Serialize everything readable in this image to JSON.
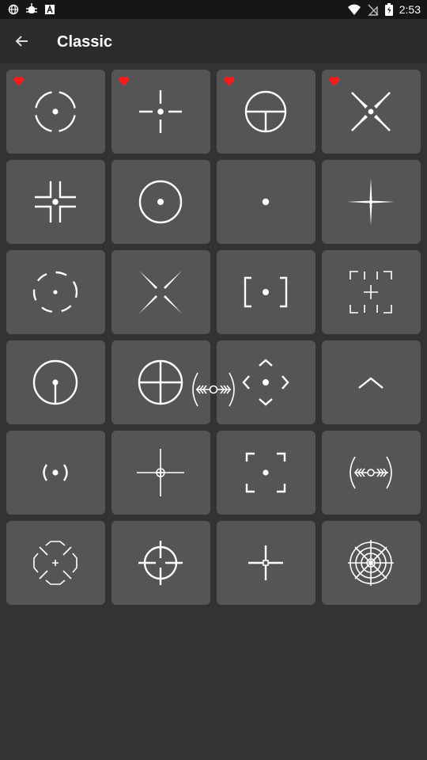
{
  "status_bar": {
    "time": "2:53",
    "left_icons": [
      "globe-icon",
      "bug-icon",
      "font-icon"
    ],
    "right_icons": [
      "wifi-icon",
      "no-sim-icon",
      "battery-icon"
    ],
    "background": "#161616"
  },
  "app_bar": {
    "title": "Classic",
    "back_icon": "arrow-back-icon",
    "background": "#2b2b2b"
  },
  "colors": {
    "background": "#333333",
    "tile": "#555555",
    "crosshair": "#ffffff",
    "favorite": "#ff1a1a"
  },
  "crosshairs": [
    {
      "id": 1,
      "style": "broken-circle-dot",
      "favorite": true
    },
    {
      "id": 2,
      "style": "cross-gap-dot",
      "favorite": true
    },
    {
      "id": 3,
      "style": "circle-t-scope",
      "favorite": true
    },
    {
      "id": 4,
      "style": "diagonal-x-dot",
      "favorite": true
    },
    {
      "id": 5,
      "style": "corner-brackets-dot",
      "favorite": false
    },
    {
      "id": 6,
      "style": "circle-dot",
      "favorite": false
    },
    {
      "id": 7,
      "style": "single-dot",
      "favorite": false
    },
    {
      "id": 8,
      "style": "tapered-star-cross",
      "favorite": false
    },
    {
      "id": 9,
      "style": "dashed-circle-dot",
      "favorite": false
    },
    {
      "id": 10,
      "style": "diagonal-blades",
      "favorite": false
    },
    {
      "id": 11,
      "style": "square-brackets-dot",
      "favorite": false
    },
    {
      "id": 12,
      "style": "frame-corners-small-cross",
      "favorite": false
    },
    {
      "id": 13,
      "style": "circle-vertical-line-dot",
      "favorite": false
    },
    {
      "id": 14,
      "style": "circle-full-cross",
      "favorite": false
    },
    {
      "id": 15,
      "style": "diamond-chevrons-dot",
      "favorite": false
    },
    {
      "id": 16,
      "style": "chevron-up",
      "favorite": false
    },
    {
      "id": 17,
      "style": "parentheses-dot",
      "favorite": false
    },
    {
      "id": 18,
      "style": "long-cross-small-circle",
      "favorite": false
    },
    {
      "id": 19,
      "style": "square-corners-dot",
      "favorite": false
    },
    {
      "id": 20,
      "style": "arcs-arrows-circle",
      "favorite": false
    },
    {
      "id": 21,
      "style": "rounded-diamond-plus",
      "favorite": false
    },
    {
      "id": 22,
      "style": "circle-cross-scope",
      "favorite": false
    },
    {
      "id": 23,
      "style": "plus-small-square",
      "favorite": false
    },
    {
      "id": 24,
      "style": "radar-reticle",
      "favorite": false
    }
  ],
  "dragging_crosshair": {
    "style": "arcs-arrows-circle"
  }
}
